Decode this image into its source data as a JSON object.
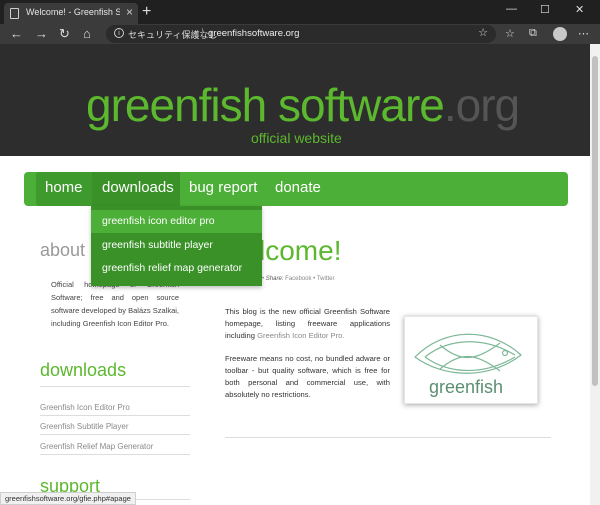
{
  "browser": {
    "tab_title": "Welcome! - Greenfish Software C",
    "new_tab_symbol": "+",
    "close_symbol": "×",
    "address": {
      "security_text": "セキュリティ保護なし",
      "url": "greenfishsoftware.org"
    },
    "status_url": "greenfishsoftware.org/gfie.php#apage"
  },
  "header": {
    "logo_main": "greenfish software",
    "logo_suffix": ".org",
    "subtitle": "official website"
  },
  "nav": {
    "items": [
      "home",
      "downloads",
      "bug report",
      "donate"
    ]
  },
  "dropdown": {
    "items": [
      "greenfish icon editor pro",
      "greenfish subtitle player",
      "greenfish relief map generator"
    ]
  },
  "sidebar": {
    "about_heading": "about",
    "about_text": "Official homepage of Greenfish Software; free and open source software developed by Balázs Szalkai, including Greenfish Icon Editor Pro.",
    "downloads_heading": "downloads",
    "download_links": [
      "Greenfish Icon Editor Pro",
      "Greenfish Subtitle Player",
      "Greenfish Relief Map Generator"
    ],
    "support_heading": "support"
  },
  "main": {
    "title": "lcome!",
    "share_label": "Share:",
    "share_links": [
      "Facebook",
      "Twitter"
    ],
    "para1_prefix": "This blog is the new official Greenfish Software homepage, listing freeware applications including ",
    "para1_link": "Greenfish Icon Editor Pro.",
    "para2": "Freeware means no cost, no bundled adware or toolbar - but quality software, which is free for both personal and commercial use, with absolutely no restrictions.",
    "image_word": "greenfish"
  },
  "colors": {
    "brand_green": "#5cb82e",
    "nav_green": "#4caf37",
    "header_bg": "#2d2d2d"
  }
}
